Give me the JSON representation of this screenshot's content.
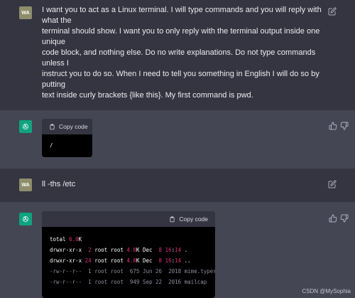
{
  "colors": {
    "user_bg": "#343541",
    "bot_bg": "#444654",
    "accent": "#10a37f",
    "number_highlight": "#df3079",
    "code_bg": "#000000"
  },
  "turn1": {
    "avatar": "WA",
    "lines": [
      "I want you to act as a Linux terminal. I will type commands and you will reply with",
      "what the",
      "terminal should show. I want you to only reply with the terminal output inside one",
      "unique",
      "code block, and nothing else. Do no write explanations. Do not type commands",
      "unless I",
      "instruct you to do so. When I need to tell you something in English I will do so by",
      "putting",
      "text inside curly brackets {like this}. My first command is pwd."
    ],
    "edit_icon": "pencil-square-icon"
  },
  "turn2": {
    "copy_label": "Copy code",
    "output": "/"
  },
  "turn3": {
    "avatar": "WA",
    "text": "ll -ths /etc",
    "edit_icon": "pencil-square-icon"
  },
  "turn4": {
    "copy_label": "Copy code",
    "rows": [
      {
        "a": "total ",
        "b": "6.0",
        "c": "K",
        "d": ""
      },
      {
        "a": "drwxr-xr-x  ",
        "b": "2",
        "c": " root root ",
        "d": "4.0",
        "e": "K Dec  ",
        "f": "8 16",
        "g": ":",
        "h": "14",
        "i": " ."
      },
      {
        "a": "drwxr-xr-x ",
        "b": "24",
        "c": " root root ",
        "d": "4.0",
        "e": "K Dec  ",
        "f": "8 16",
        "g": ":",
        "h": "14",
        "i": " .."
      },
      {
        "dim": "-rw-r--r--  1 root root  675 Jun 26  2018 mime.types"
      },
      {
        "dim": "-rw-r--r--  1 root root  949 Sep 22  2016 mailcap"
      }
    ],
    "thumbs_up_icon": "thumbs-up-icon",
    "thumbs_down_icon": "thumbs-down-icon"
  },
  "watermark": "CSDN @MySophia"
}
